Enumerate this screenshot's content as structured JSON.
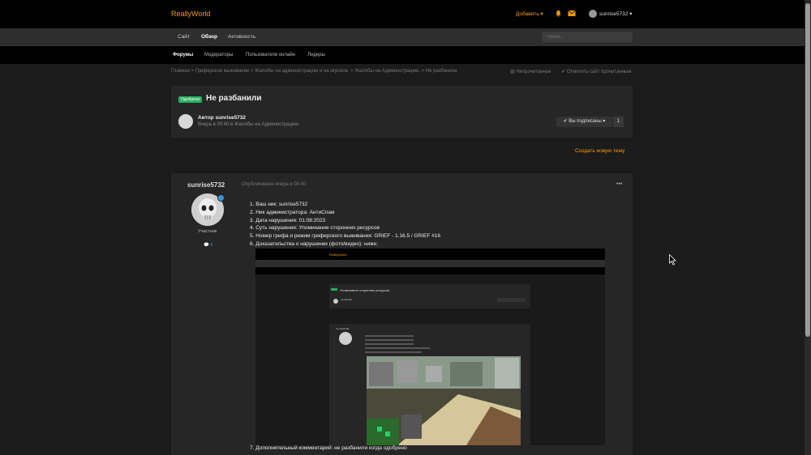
{
  "header": {
    "logo": "ReallyWorld",
    "add_label": "Добавить ▾",
    "username": "sunrise5732 ▾",
    "accent": "#f39c12"
  },
  "nav": {
    "items": [
      "Сайт",
      "Обзор",
      "Активность"
    ],
    "active": "Обзор",
    "search_placeholder": "Поиск..."
  },
  "subnav": {
    "items": [
      "Форумы",
      "Модераторы",
      "Пользователи онлайн",
      "Лидеры"
    ],
    "active": "Форумы"
  },
  "breadcrumb": {
    "items": [
      "Главная",
      "Гриферское выживание",
      "Жалобы на администрацию и на игроков.",
      "Жалобы на Администрацию.",
      "Не разбанили"
    ],
    "separator": " > ",
    "unread": "Непрочитанное",
    "mark_read": "Отметить сайт прочитанным"
  },
  "topic": {
    "badge": "Одобрено",
    "title": "Не разбанили",
    "author_line": "Автор sunrise5732",
    "meta": "Вчера в 00:40 в Жалобы на Администрацию.",
    "follow_label": "✔ Вы подписаны ▾",
    "follow_count": "1",
    "new_topic": "Создать новую тему"
  },
  "post": {
    "author": "sunrise5732",
    "date": "Опубликовано вчера в 00:40",
    "menu": "•••",
    "role": "Участник",
    "posts_count": "💬 5",
    "lines": [
      "1. Ваш ник: sunrise5732",
      "2. Ник администратора: АнтиСпам",
      "3. Дата нарушения: 01:08:2023",
      "4. Суть нарушения: Упоминание сторонних ресурсов",
      "5. Номер грифа и режим гриферского выживания: GRIEF - 1.16.5  /  GRIEF #16",
      "6. Доказательства о нарушении (фото/видео): ниже;"
    ],
    "last_line": "7. Дополнительный комментарий: не разбанили когда одобрено"
  },
  "embed": {
    "logo": "ReallyWorld",
    "topic_title": "Упоминание сторонних ресурсов",
    "author": "sunrise5732"
  }
}
